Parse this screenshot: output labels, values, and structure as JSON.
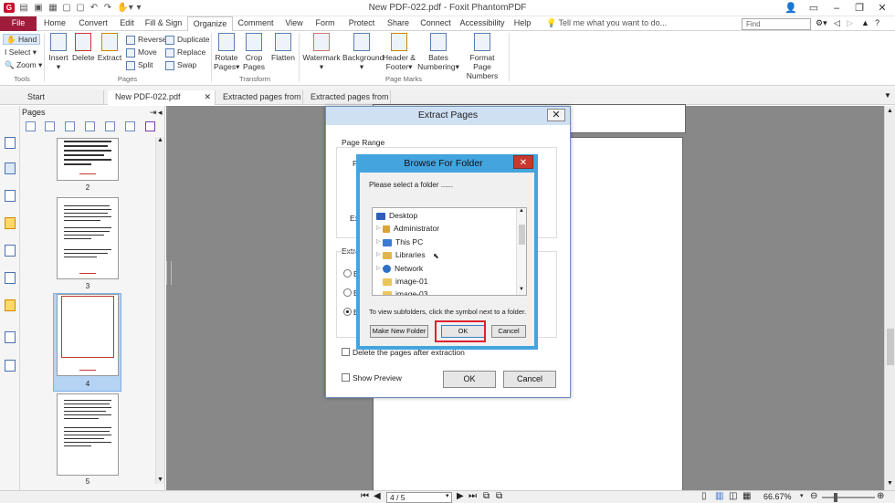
{
  "app": {
    "title": "New PDF-022.pdf - Foxit PhantomPDF",
    "find_placeholder": "Find",
    "tell_me": "Tell me what you want to do..."
  },
  "menu_tabs": [
    "File",
    "Home",
    "Convert",
    "Edit",
    "Fill & Sign",
    "Organize",
    "Comment",
    "View",
    "Form",
    "Protect",
    "Share",
    "Connect",
    "Accessibility",
    "Help"
  ],
  "ribbon": {
    "tools": {
      "hand": "Hand",
      "select": "Select",
      "zoom": "Zoom",
      "group": "Tools"
    },
    "pages": {
      "insert": "Insert",
      "delete": "Delete",
      "extract": "Extract",
      "reverse": "Reverse",
      "move": "Move",
      "split": "Split",
      "duplicate": "Duplicate",
      "replace": "Replace",
      "swap": "Swap",
      "group": "Pages"
    },
    "transform": {
      "rotate": "Rotate",
      "rotate2": "Pages",
      "crop": "Crop",
      "crop2": "Pages",
      "flatten": "Flatten",
      "group": "Transform"
    },
    "page_marks": {
      "watermark": "Watermark",
      "background": "Background",
      "header": "Header &",
      "header2": "Footer",
      "bates": "Bates",
      "bates2": "Numbering",
      "format": "Format Page",
      "format2": "Numbers",
      "group": "Page Marks"
    }
  },
  "doc_tabs": [
    "Start",
    "New PDF-022.pdf",
    "Extracted pages from ...",
    "Extracted pages from ..."
  ],
  "pages_panel": {
    "title": "Pages",
    "thumb_labels": [
      "2",
      "3",
      "4",
      "5"
    ]
  },
  "status": {
    "page_field": "4 / 5",
    "zoom": "66.67%"
  },
  "extract_dialog": {
    "title": "Extract Pages",
    "page_range": "Page Range",
    "p_stub": "P",
    "ex_stub": "Ex",
    "extract_stub": "Extra",
    "radio_stub": "E",
    "delete_label": "Delete the pages after extraction",
    "preview_label": "Show Preview",
    "ok": "OK",
    "cancel": "Cancel"
  },
  "browse_dialog": {
    "title": "Browse For Folder",
    "prompt": "Please select a folder ......",
    "tree": [
      "Desktop",
      "Administrator",
      "This PC",
      "Libraries",
      "Network",
      "image-01",
      "image-03"
    ],
    "hint": "To view subfolders, click the symbol next to a folder.",
    "make_new_folder": "Make New Folder",
    "ok": "OK",
    "cancel": "Cancel"
  },
  "colors": {
    "file_tab": "#9f1d3b",
    "accent_blue": "#43a4de",
    "highlight_red": "#e02030",
    "selected_thumb": "#b5d3f5"
  }
}
